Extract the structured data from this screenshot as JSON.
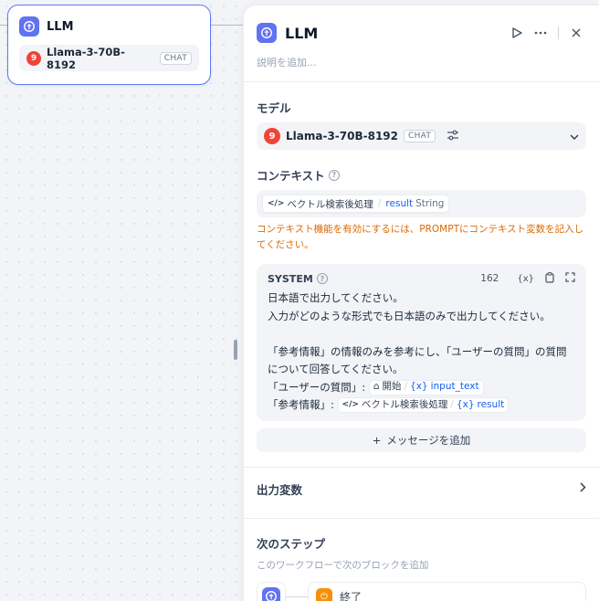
{
  "canvas": {
    "node": {
      "title": "LLM",
      "model_badge": "9",
      "model_name": "Llama-3-70B-8192",
      "model_tag": "CHAT"
    }
  },
  "panel": {
    "title": "LLM",
    "description_placeholder": "説明を追加...",
    "model": {
      "label": "モデル",
      "badge": "9",
      "name": "Llama-3-70B-8192",
      "tag": "CHAT"
    },
    "context": {
      "label": "コンテキスト",
      "chip_node": "ベクトル検索後処理",
      "chip_var": "result",
      "chip_type": "String",
      "warning": "コンテキスト機能を有効にするには、PROMPTにコンテキスト変数を記入してください。"
    },
    "system": {
      "title": "SYSTEM",
      "char_count": "162",
      "line1": "日本語で出力してください。",
      "line2": "入力がどのような形式でも日本語のみで出力してください。",
      "line3": "「参考情報」の情報のみを参考にし、「ユーザーの質問」の質問について回答してください。",
      "line4_prefix": "「ユーザーの質問」:",
      "ref1_node": "開始",
      "ref1_var": "input_text",
      "line5_prefix": "「参考情報」:",
      "ref2_node": "ベクトル検索後処理",
      "ref2_var": "result"
    },
    "add_message": "メッセージを追加",
    "output_vars": "出力変数",
    "next_step": {
      "title": "次のステップ",
      "subtitle": "このワークフローで次のブロックを追加",
      "target": "終了"
    }
  },
  "colors": {
    "accent": "#6172f3",
    "node_border": "#5c7cf2",
    "warning": "#dc6803",
    "model_badge": "#f04438",
    "variable": "#155eef",
    "end_icon": "#f79009"
  }
}
